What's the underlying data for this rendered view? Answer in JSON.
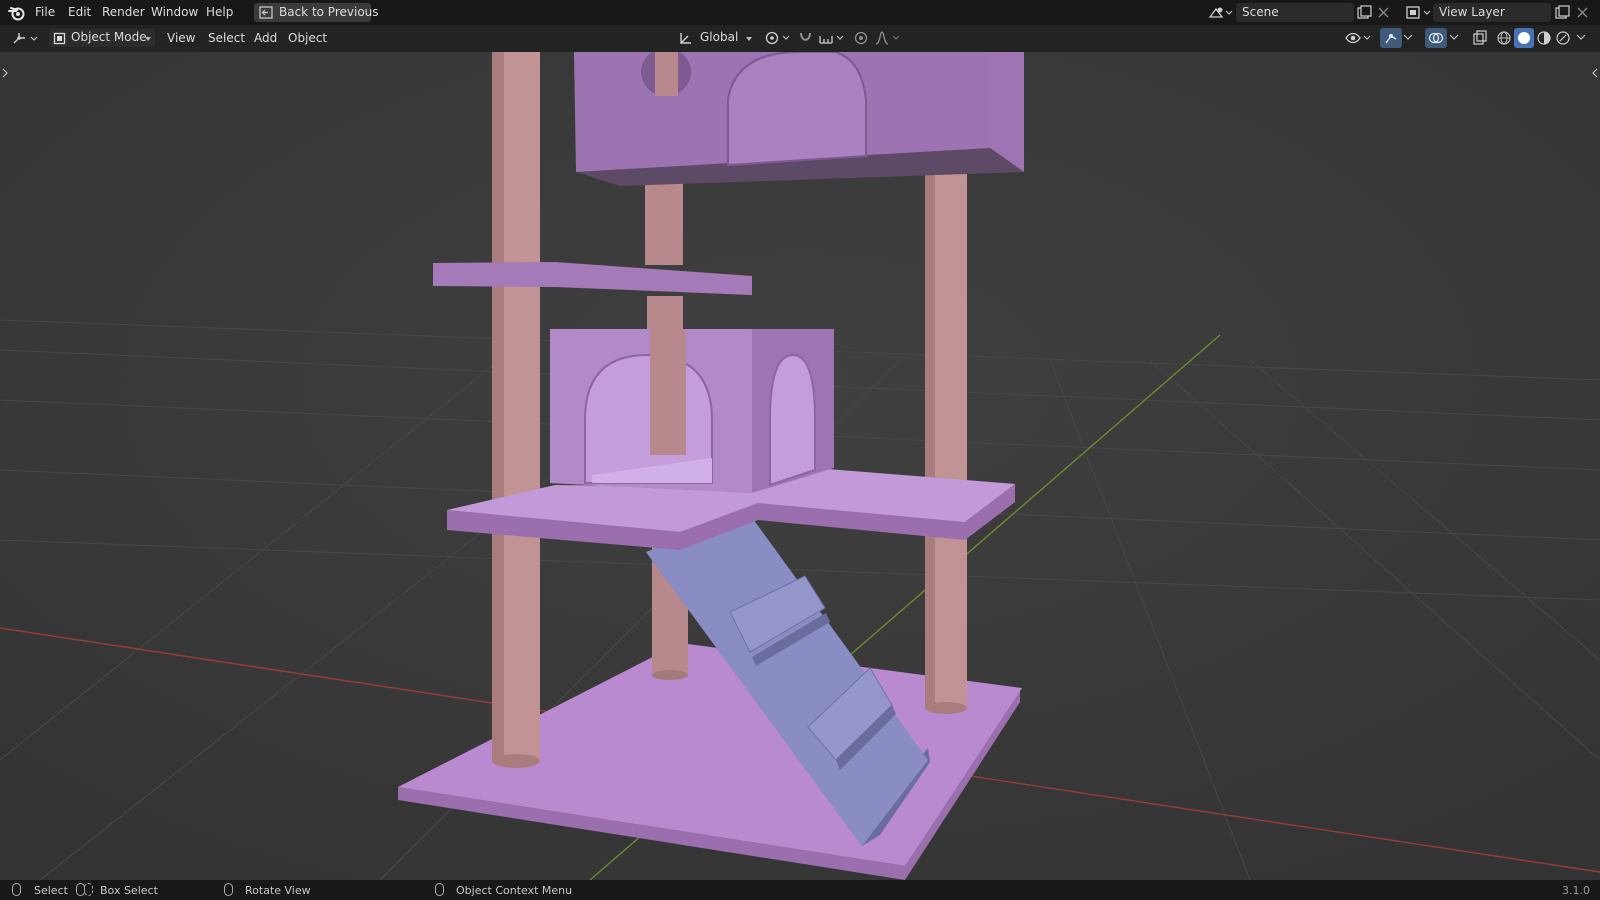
{
  "menu": {
    "items": [
      "File",
      "Edit",
      "Render",
      "Window",
      "Help"
    ],
    "back_button": "Back to Previous"
  },
  "scene": {
    "name": "Scene"
  },
  "view_layer": {
    "name": "View Layer"
  },
  "header": {
    "mode": "Object Mode",
    "menus": [
      "View",
      "Select",
      "Add",
      "Object"
    ],
    "transform_orientation": "Global"
  },
  "status": {
    "select": "Select",
    "box_select": "Box Select",
    "rotate_view": "Rotate View",
    "context_menu": "Object Context Menu",
    "version": "3.1.0"
  },
  "icons": [
    "blender-logo-icon",
    "back-icon",
    "scene-icon",
    "view-layer-icon",
    "editor-type-icon",
    "object-mode-icon",
    "orientation-icon",
    "pivot-icon",
    "snap-icon",
    "proportional-icon",
    "visibility-icon",
    "gizmo-icon",
    "overlay-icon",
    "xray-icon",
    "shading-wireframe-icon",
    "shading-solid-icon",
    "shading-material-icon",
    "shading-rendered-icon"
  ],
  "colors": {
    "accent_model": "#b48ac4",
    "ramp": "#8a8cc4",
    "posts": "#c29394",
    "x_axis": "#9a3b3b",
    "y_axis": "#6b8a2e"
  }
}
